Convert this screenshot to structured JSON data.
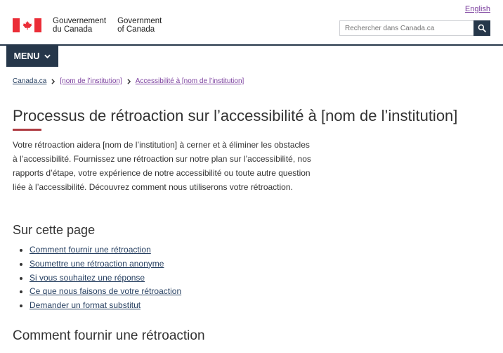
{
  "header": {
    "language_toggle": "English",
    "signature_fr": [
      "Gouvernement",
      "du Canada"
    ],
    "signature_en": [
      "Government",
      "of Canada"
    ],
    "search_placeholder": "Rechercher dans Canada.ca",
    "menu_label": "MENU",
    "colors": {
      "navy": "#26374a",
      "flag_red": "#eb2d37",
      "visited_link": "#7b3f9e"
    }
  },
  "breadcrumb": [
    {
      "label": "Canada.ca"
    },
    {
      "label": "[nom de l’institution]"
    },
    {
      "label": "Accessibilité à [nom de l’institution]"
    }
  ],
  "main": {
    "title": "Processus de rétroaction sur l’accessibilité à [nom de l’institution]",
    "intro": "Votre rétroaction aidera [nom de l’institution] à cerner et à éliminer les obstacles à l’accessibilité. Fournissez une rétroaction sur notre plan sur l’accessibilité, nos rapports d’étape, votre expérience de notre accessibilité ou toute autre question liée à l’accessibilité. Découvrez comment nous utiliserons votre rétroaction.",
    "on_this_page_heading": "Sur cette page",
    "toc": [
      "Comment fournir une rétroaction",
      "Soumettre une rétroaction anonyme",
      "Si vous souhaitez une réponse",
      "Ce que nous faisons de votre rétroaction",
      "Demander un format substitut"
    ],
    "section_heading": "Comment fournir une rétroaction"
  }
}
